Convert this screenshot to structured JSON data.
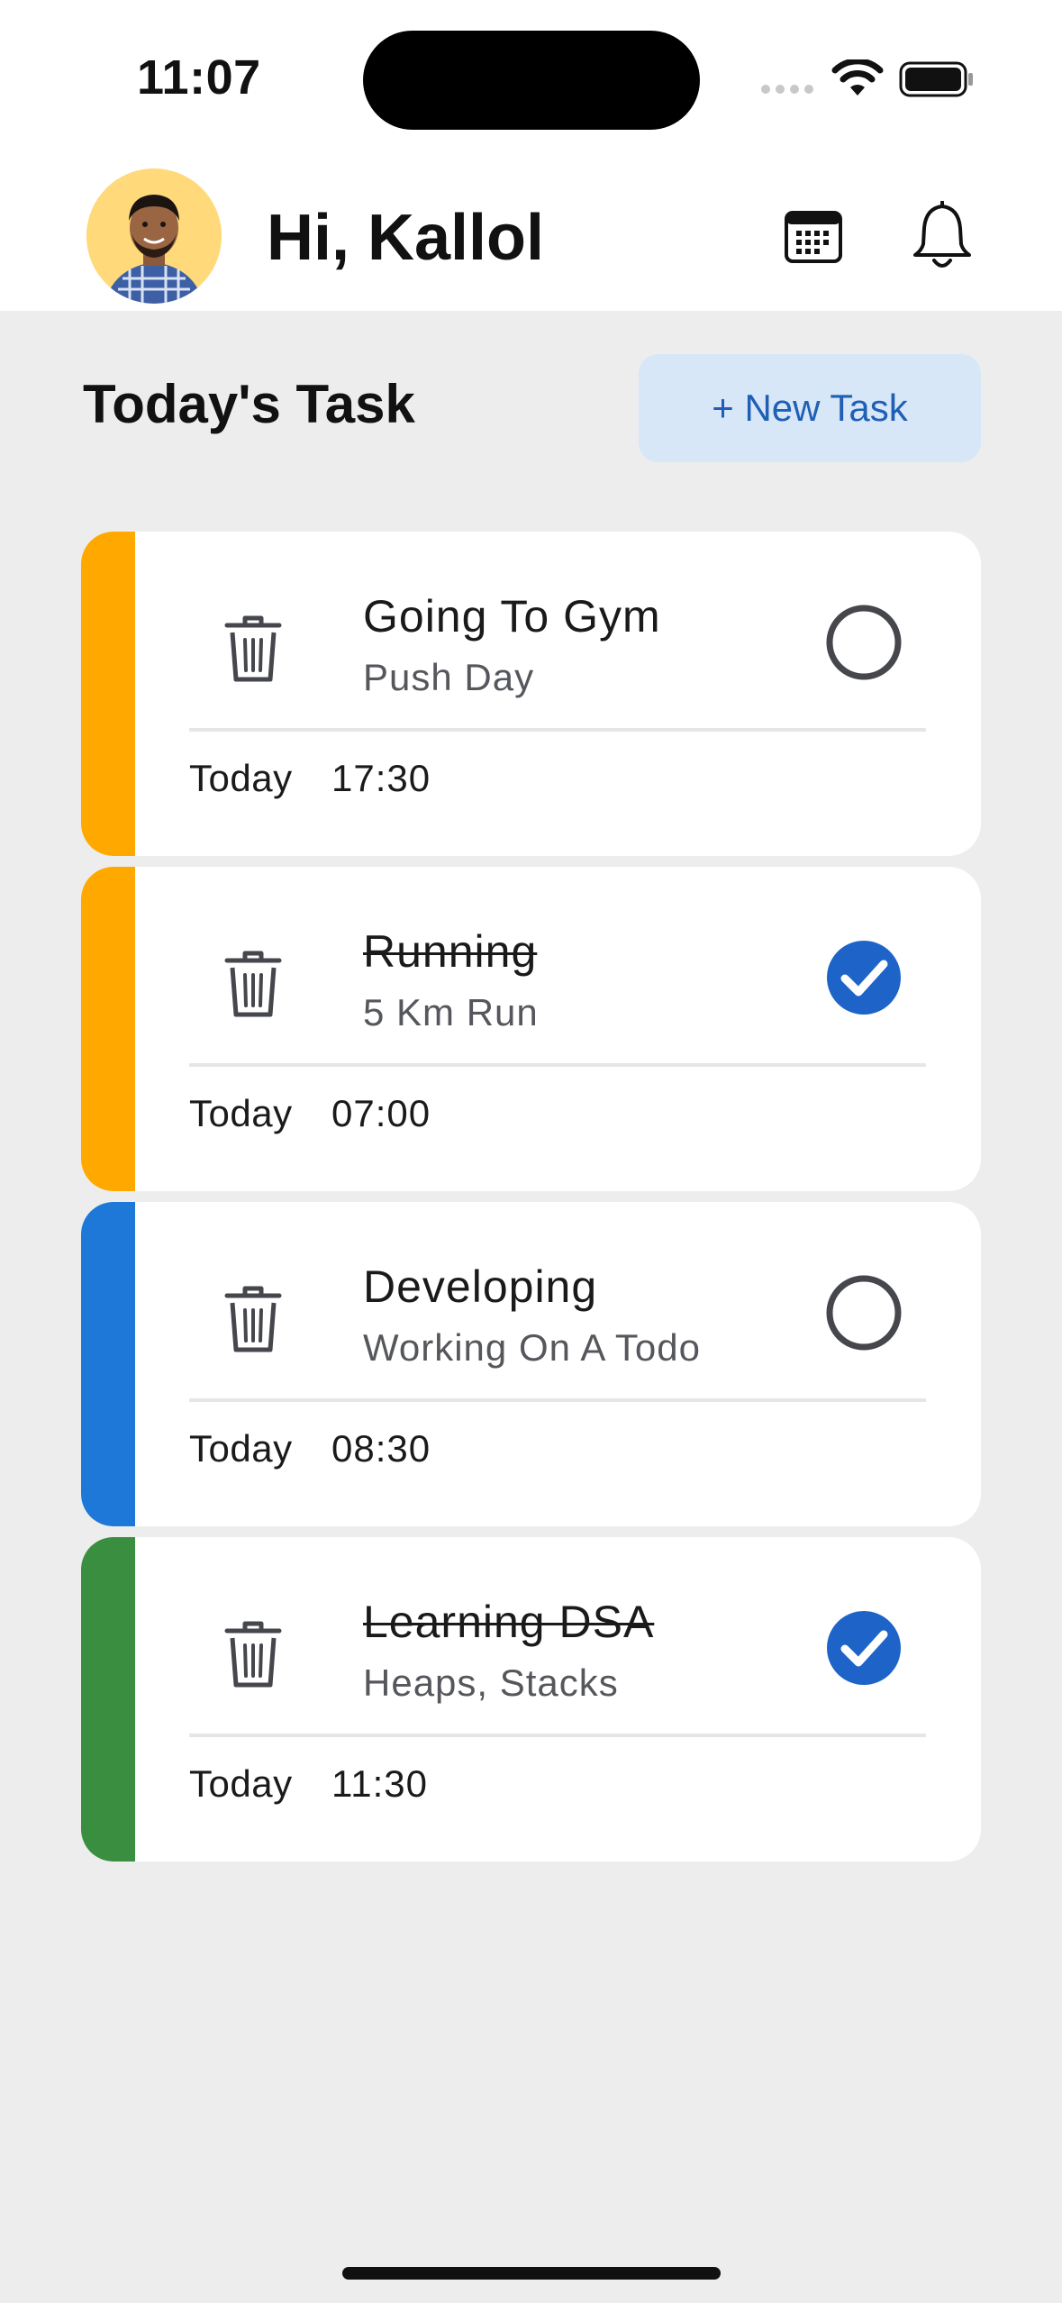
{
  "status_bar": {
    "time": "11:07",
    "icons": [
      "signal-dots-icon",
      "wifi-icon",
      "battery-icon"
    ]
  },
  "header": {
    "greeting": "Hi, Kallol",
    "avatar": "user-avatar",
    "actions": [
      "calendar-icon",
      "bell-icon"
    ]
  },
  "section": {
    "title": "Today's Task",
    "new_task_label": "+ New Task"
  },
  "tasks": [
    {
      "title": "Going To Gym",
      "subtitle": "Push Day",
      "day": "Today",
      "time": "17:30",
      "completed": false,
      "color": "#FFA800"
    },
    {
      "title": "Running",
      "subtitle": "5 Km Run",
      "day": "Today",
      "time": "07:00",
      "completed": true,
      "color": "#FFA800"
    },
    {
      "title": "Developing",
      "subtitle": "Working On A Todo",
      "day": "Today",
      "time": "08:30",
      "completed": false,
      "color": "#1E78D7"
    },
    {
      "title": "Learning DSA",
      "subtitle": "Heaps, Stacks",
      "day": "Today",
      "time": "11:30",
      "completed": true,
      "color": "#3A8E3F"
    }
  ],
  "colors": {
    "accent": "#1E64C8",
    "button_bg": "#D7E7F8",
    "background": "#EDEDED"
  }
}
